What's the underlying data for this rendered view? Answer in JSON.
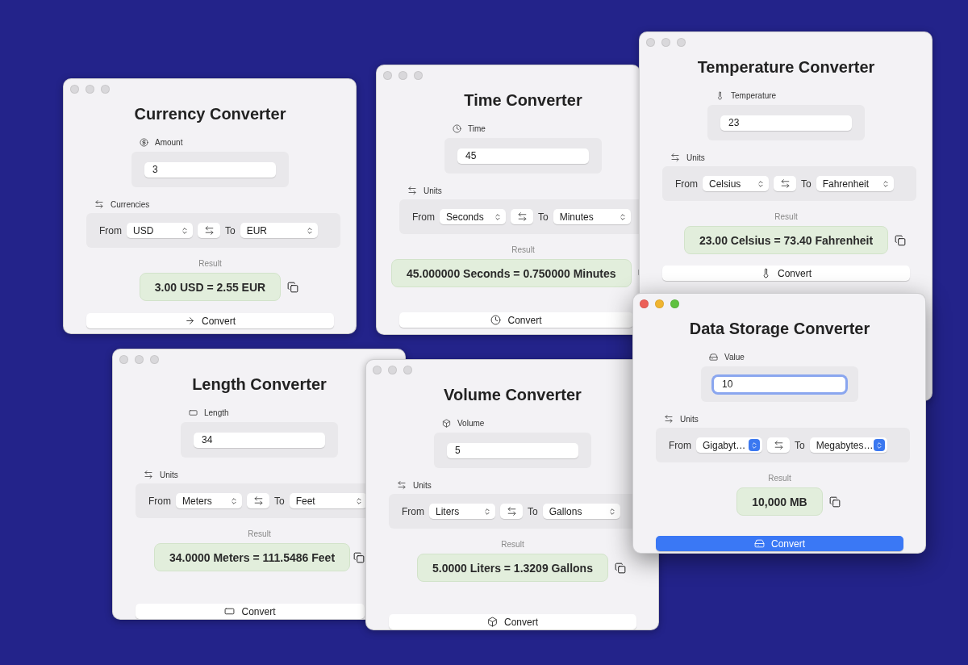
{
  "windows": [
    {
      "kind": "currency",
      "active": false,
      "title": "Currency Converter",
      "value_label": "Amount",
      "value": "3",
      "units_label": "Currencies",
      "from_label": "From",
      "from": "USD",
      "to_label": "To",
      "to": "EUR",
      "result_label": "Result",
      "result": "3.00 USD = 2.55 EUR",
      "button": "Convert"
    },
    {
      "kind": "time",
      "active": false,
      "title": "Time Converter",
      "value_label": "Time",
      "value": "45",
      "units_label": "Units",
      "from_label": "From",
      "from": "Seconds",
      "to_label": "To",
      "to": "Minutes",
      "result_label": "Result",
      "result": "45.000000 Seconds = 0.750000 Minutes",
      "button": "Convert"
    },
    {
      "kind": "temperature",
      "active": false,
      "title": "Temperature Converter",
      "value_label": "Temperature",
      "value": "23",
      "units_label": "Units",
      "from_label": "From",
      "from": "Celsius",
      "to_label": "To",
      "to": "Fahrenheit",
      "result_label": "Result",
      "result": "23.00 Celsius = 73.40 Fahrenheit",
      "button": "Convert"
    },
    {
      "kind": "length",
      "active": false,
      "title": "Length Converter",
      "value_label": "Length",
      "value": "34",
      "units_label": "Units",
      "from_label": "From",
      "from": "Meters",
      "to_label": "To",
      "to": "Feet",
      "result_label": "Result",
      "result": "34.0000 Meters = 111.5486 Feet",
      "button": "Convert"
    },
    {
      "kind": "volume",
      "active": false,
      "title": "Volume Converter",
      "value_label": "Volume",
      "value": "5",
      "units_label": "Units",
      "from_label": "From",
      "from": "Liters",
      "to_label": "To",
      "to": "Gallons",
      "result_label": "Result",
      "result": "5.0000 Liters = 1.3209 Gallons",
      "button": "Convert"
    },
    {
      "kind": "data",
      "active": true,
      "title": "Data Storage Converter",
      "value_label": "Value",
      "value": "10",
      "units_label": "Units",
      "from_label": "From",
      "from": "Gigabyt…",
      "to_label": "To",
      "to": "Megabytes…",
      "result_label": "Result",
      "result": "10,000 MB",
      "button": "Convert"
    }
  ]
}
